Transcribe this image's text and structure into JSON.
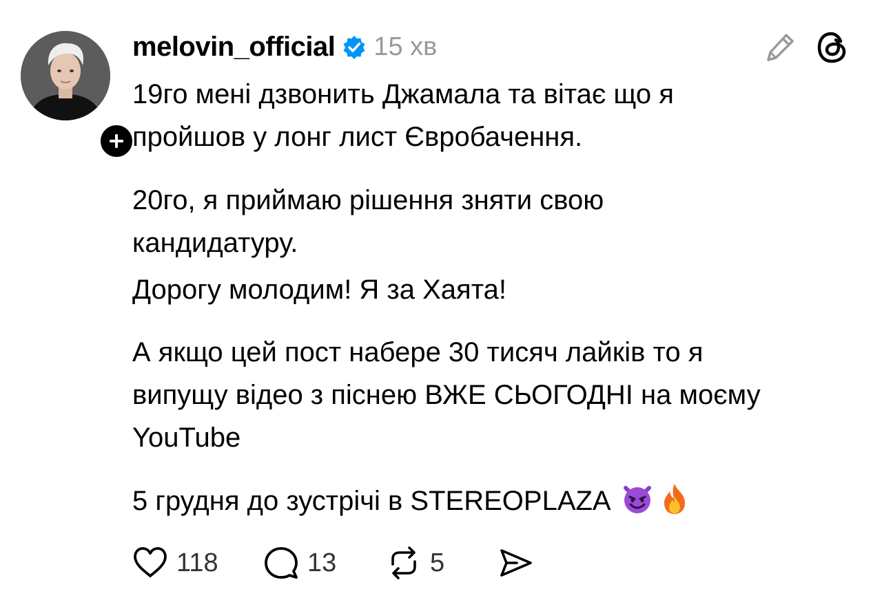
{
  "post": {
    "username": "melovin_official",
    "timestamp": "15 хв",
    "paragraphs": {
      "p1": [
        "19го мені дзвонить Джамала та вітає що я",
        "пройшов у лонг лист Євробачення."
      ],
      "p2": [
        "20го, я приймаю рішення зняти свою",
        "кандидатуру."
      ],
      "p3": [
        "Дорогу молодим! Я за Хаята!"
      ],
      "p4": [
        "А якщо цей пост набере 30 тисяч лайків то я",
        "випущу відео з піснею ВЖЕ СЬОГОДНІ на моєму",
        "YouTube"
      ],
      "p5": [
        "5 грудня до зустрічі в STEREOPLAZA"
      ]
    },
    "emojis": [
      "smiling-imp-emoji",
      "fire-emoji"
    ],
    "actions": {
      "likes": "118",
      "replies": "13",
      "reposts": "5"
    }
  },
  "icons": [
    "follow-plus-icon",
    "verified-badge-icon",
    "edit-pencil-icon",
    "threads-logo-icon",
    "heart-icon",
    "comment-icon",
    "repost-icon",
    "share-icon"
  ],
  "colors": {
    "verified": "#0095f6",
    "text": "#000000",
    "muted": "#999999"
  }
}
